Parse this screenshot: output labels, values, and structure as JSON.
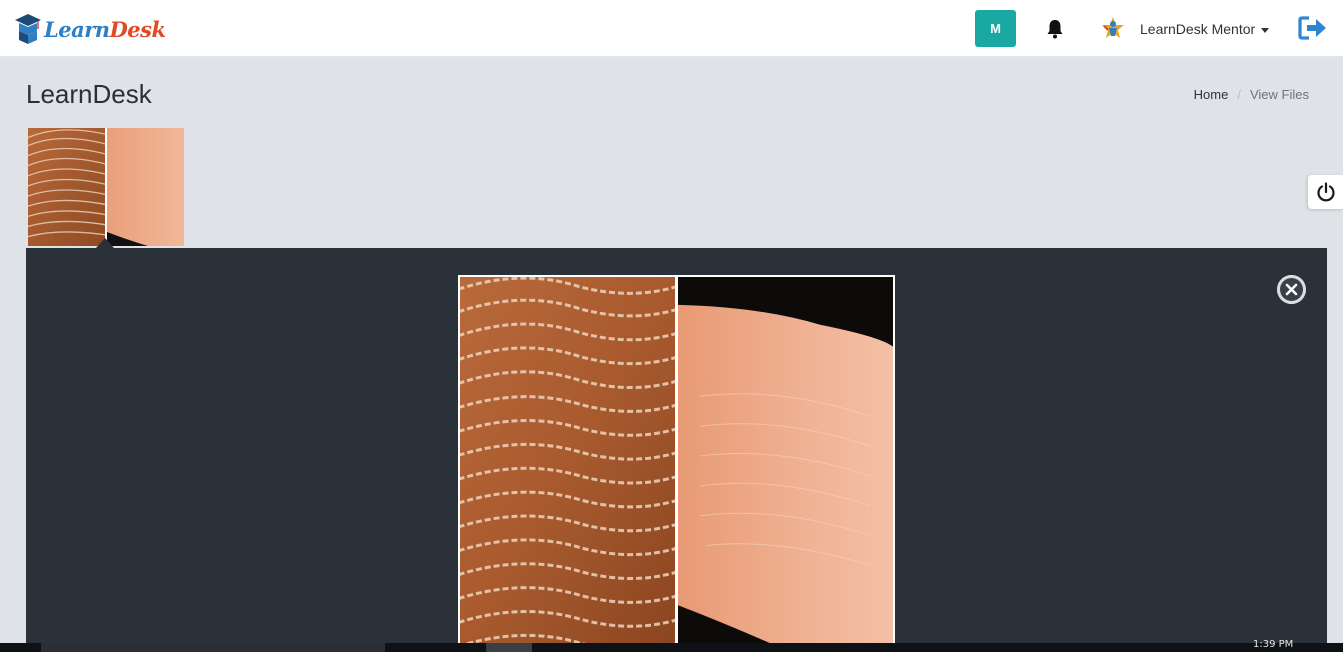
{
  "header": {
    "logo": {
      "part1": "Learn",
      "part2": "Desk"
    },
    "avatar_initial": "M",
    "user_name": "LearnDesk Mentor",
    "icons": {
      "logo": "graduation-cap-logo-icon",
      "notifications": "bell-icon",
      "user": "user-star-icon",
      "logout": "logout-icon"
    }
  },
  "page": {
    "title": "LearnDesk",
    "breadcrumb": {
      "home": "Home",
      "separator": "/",
      "current": "View Files"
    }
  },
  "side_tab": {
    "icon": "power-icon"
  },
  "files": [
    {
      "name": "fingerprint-comparison",
      "preview": "fingerprint ridges close-up beside fingertip photo"
    }
  ],
  "preview": {
    "close_icon": "close-icon"
  },
  "taskbar": {
    "clock": "1:39 PM"
  },
  "colors": {
    "accent_teal": "#19a8a2",
    "logo_blue": "#2f7fc4",
    "logo_red": "#e04a25",
    "logout_blue": "#2e86d3",
    "panel_dark": "#2b3138",
    "page_bg": "#dfe2e6"
  }
}
